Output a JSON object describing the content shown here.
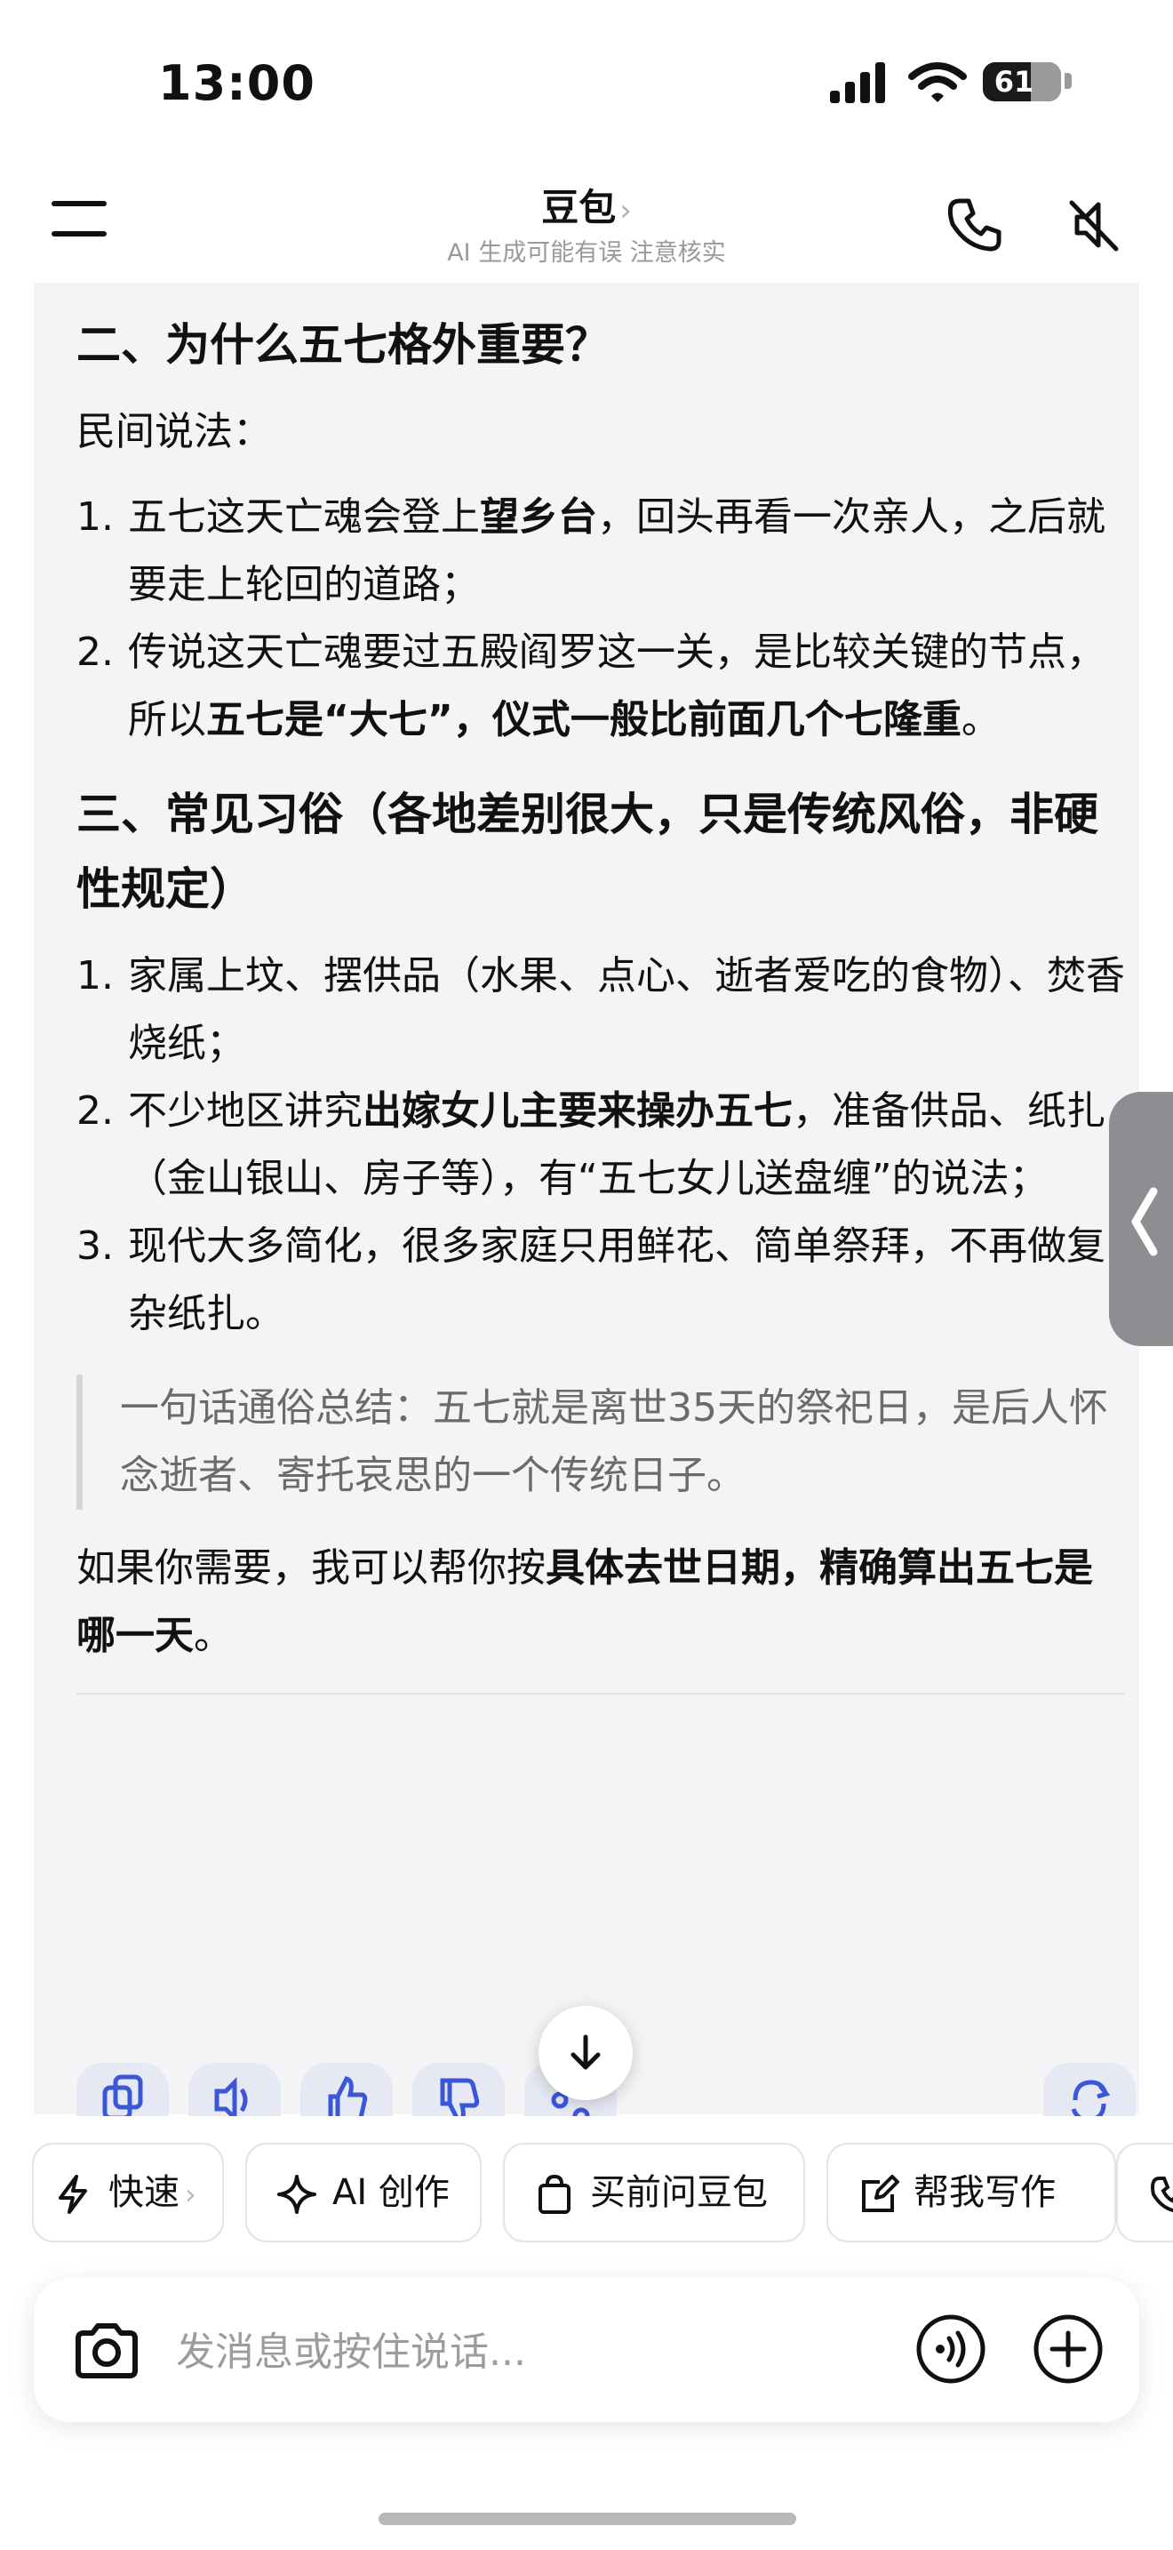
{
  "status_bar": {
    "time": "13:00",
    "battery": "61",
    "battery_level": 0.61,
    "icons": [
      "signal-icon",
      "wifi-icon",
      "battery-icon"
    ]
  },
  "header": {
    "title": "豆包",
    "title_chevron": "›",
    "subtitle": "AI 生成可能有误 注意核实",
    "icons": [
      "menu-icon",
      "phone-icon",
      "speaker-muted-icon"
    ]
  },
  "message": {
    "section2_heading": "二、为什么五七格外重要？",
    "folk_label": "民间说法：",
    "folk_items": [
      {
        "num": "1.",
        "pre": "五七这天亡魂会登上",
        "bold": "望乡台",
        "post": "，回头再看一次亲人，之后就要走上轮回的道路；"
      },
      {
        "num": "2.",
        "pre": "传说这天亡魂要过五殿阎罗这一关，是比较关键的节点，所以",
        "bold": "五七是“大七”，仪式一般比前面几个七隆重",
        "post": "。"
      }
    ],
    "section3_heading": "三、常见习俗（各地差别很大，只是传统风俗，非硬性规定）",
    "custom_items": [
      {
        "num": "1.",
        "pre": "家属上坟、摆供品（水果、点心、逝者爱吃的食物）、焚香烧纸；",
        "bold": "",
        "post": ""
      },
      {
        "num": "2.",
        "pre": "不少地区讲究",
        "bold": "出嫁女儿主要来操办五七",
        "post": "，准备供品、纸扎（金山银山、房子等），有“五七女儿送盘缠”的说法；"
      },
      {
        "num": "3.",
        "pre": "现代大多简化，很多家庭只用鲜花、简单祭拜，不再做复杂纸扎。",
        "bold": "",
        "post": ""
      }
    ],
    "quote": "一句话通俗总结：五七就是离世35天的祭祀日，是后人怀念逝者、寄托哀思的一个传统日子。",
    "closing_pre": "如果你需要，我可以帮你按",
    "closing_bold": "具体去世日期，精确算出五七是哪一天",
    "closing_post": "。"
  },
  "actions": [
    "copy-icon",
    "speaker-icon",
    "thumbs-up-icon",
    "thumbs-down-icon",
    "share-icon",
    "regenerate-icon"
  ],
  "quick_chips": [
    {
      "label": "快速",
      "suffix": "›",
      "icon": "lightning-icon"
    },
    {
      "label": "AI 创作",
      "icon": "sparkle-icon"
    },
    {
      "label": "买前问豆包",
      "icon": "shopping-bag-icon"
    },
    {
      "label": "帮我写作",
      "icon": "edit-icon"
    },
    {
      "label": "",
      "icon": "phone-icon"
    }
  ],
  "input": {
    "placeholder": "发消息或按住说话...",
    "value": ""
  },
  "colors": {
    "background": "#ffffff",
    "card": "#f4f4f6",
    "text": "#111111",
    "muted": "#9a9a9a",
    "quote_text": "#6b6b6b",
    "action_bg": "#e6e8f3"
  }
}
